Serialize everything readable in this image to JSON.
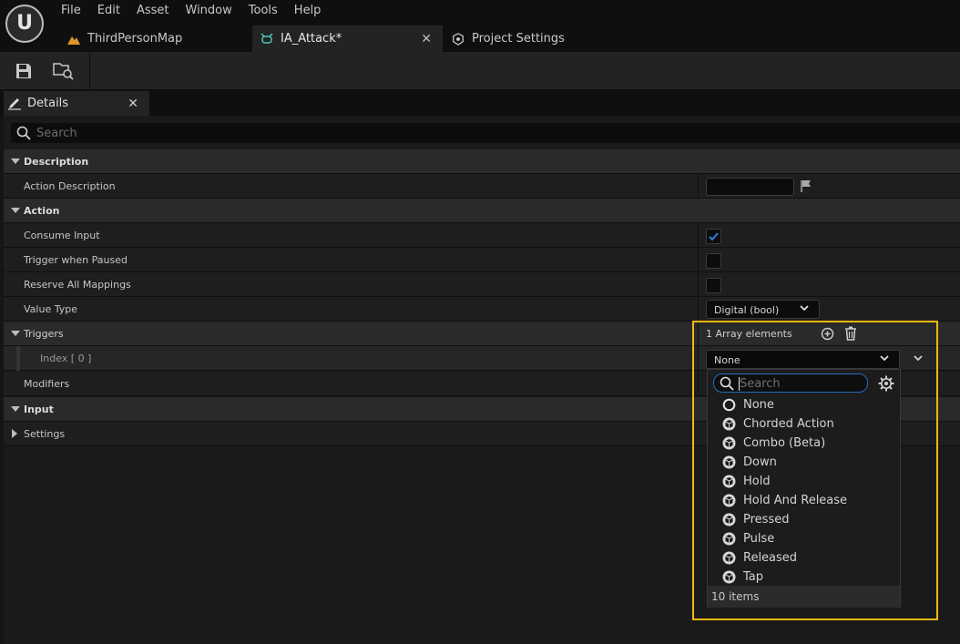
{
  "menu": [
    "File",
    "Edit",
    "Asset",
    "Window",
    "Tools",
    "Help"
  ],
  "tabs": [
    {
      "label": "ThirdPersonMap"
    },
    {
      "label": "IA_Attack*"
    },
    {
      "label": "Project Settings"
    }
  ],
  "details": {
    "tab_label": "Details",
    "search_placeholder": "Search"
  },
  "rows": {
    "description": "Description",
    "action_description": "Action Description",
    "action": "Action",
    "consume_input": "Consume Input",
    "trigger_when_paused": "Trigger when Paused",
    "reserve_all_mappings": "Reserve All Mappings",
    "value_type": "Value Type",
    "value_type_value": "Digital (bool)",
    "triggers": "Triggers",
    "array_elements": "1 Array elements",
    "index0": "Index [ 0 ]",
    "index0_value": "None",
    "modifiers": "Modifiers",
    "input": "Input",
    "settings": "Settings"
  },
  "checkboxes": {
    "consume_input": true,
    "trigger_when_paused": false,
    "reserve_all_mappings": false
  },
  "dropdown": {
    "search_placeholder": "Search",
    "items": [
      "None",
      "Chorded Action",
      "Combo (Beta)",
      "Down",
      "Hold",
      "Hold And Release",
      "Pressed",
      "Pulse",
      "Released",
      "Tap"
    ],
    "footer": "10 items"
  },
  "colors": {
    "highlight": "#f5b80f",
    "accent": "#1f6fb8",
    "check": "#2f7fd6"
  }
}
